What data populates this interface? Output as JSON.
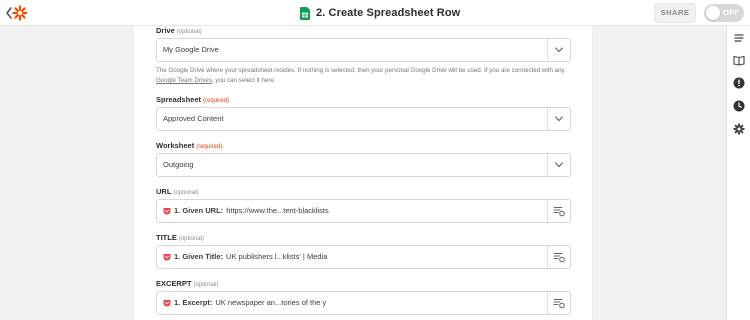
{
  "header": {
    "title": "2. Create Spreadsheet Row",
    "share_label": "SHARE",
    "toggle_label": "OFF"
  },
  "icons": {
    "back": "chevron-left-icon",
    "logo": "zapier-logo-icon",
    "sheets": "google-sheets-icon",
    "rail": [
      "list-icon",
      "book-icon",
      "alert-icon",
      "clock-icon",
      "gear-icon"
    ]
  },
  "colors": {
    "brand": "#ff4a00",
    "sheets_green": "#0f9d58",
    "required": "#d8460f",
    "pocket_red": "#ef4056"
  },
  "form": {
    "drive": {
      "label": "Drive",
      "tag": "(optional)",
      "value": "My Google Drive",
      "help_1": "The Google Drive where your spreadsheet resides. If nothing is selected, then your personal Google Drive will be used. If you are connected with any ",
      "help_link": "Google Team Drives",
      "help_2": ", you can select it here."
    },
    "spreadsheet": {
      "label": "Spreadsheet",
      "tag": "(required)",
      "value": "Approved Content"
    },
    "worksheet": {
      "label": "Worksheet",
      "tag": "(required)",
      "value": "Outgoing"
    },
    "url": {
      "label": "URL",
      "tag": "(optional)",
      "key": "1. Given URL:",
      "value": "https://www.the...tent-blacklists"
    },
    "title": {
      "label": "TITLE",
      "tag": "(optional)",
      "key": "1. Given Title:",
      "value": "UK publishers l...klists' | Media"
    },
    "excerpt": {
      "label": "EXCERPT",
      "tag": "(optional)",
      "key": "1. Excerpt:",
      "value": "UK newspaper an...tories of the y"
    }
  }
}
